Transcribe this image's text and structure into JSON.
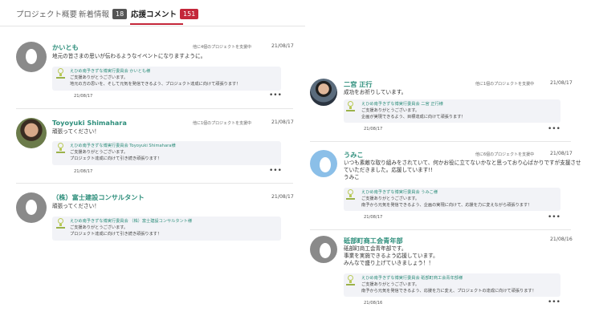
{
  "tabs": [
    {
      "label": "プロジェクト概要"
    },
    {
      "label": "新着情報",
      "badge": "18",
      "badge_color": "#555555"
    },
    {
      "label": "応援コメント",
      "badge": "151",
      "badge_color": "#c4273a"
    }
  ],
  "accent_color": "#c4273a",
  "name_color": "#2f8f7c",
  "comments": [
    {
      "name": "かいとも",
      "support": "他に4個のプロジェクトを支援中",
      "date": "21/08/17",
      "body": [
        "地元の皆さまの思いが伝わるようなイベントになりますように。"
      ],
      "reply": [
        "えひめ南予きずな博実行委員会 かいとも様",
        "ご支援ありがとうございます。",
        "地元の方の思いを、そして元気を発信できるよう、プロジェクト達成に向けて頑張ります！"
      ],
      "reply_date": "21/08/17",
      "avatar": "default-gray"
    },
    {
      "name": "Toyoyuki Shimahara",
      "support": "他に1個のプロジェクトを支援中",
      "date": "21/08/17",
      "body": [
        "頑張ってください！"
      ],
      "reply": [
        "えひめ南予きずな博実行委員会 Toyoyuki Shimahara様",
        "ご支援ありがとうございます。",
        "プロジェクト達成に向けて引き続き頑張ります！"
      ],
      "reply_date": "21/08/17",
      "avatar": "photo"
    },
    {
      "name": "（株）富士建設コンサルタント",
      "support": "",
      "date": "21/08/17",
      "body": [
        "頑張ってください！"
      ],
      "reply": [
        "えひめ南予きずな博実行委員会 （株）富士建設コンサルタント様",
        "ご支援ありがとうございます。",
        "プロジェクト達成に向けて引き続き頑張ります！"
      ],
      "reply_date": "",
      "avatar": "default-gray"
    },
    {
      "name": "二宮 正行",
      "support": "他に1個のプロジェクトを支援中",
      "date": "21/08/17",
      "body": [
        "成功をお祈りしています。"
      ],
      "reply": [
        "えひめ南予きずな博実行委員会 二宮 正行様",
        "ご支援ありがとうございます。",
        "企画が実現できるよう、目標達成に向けて頑張ります！"
      ],
      "reply_date": "21/08/17",
      "avatar": "photo"
    },
    {
      "name": "うみこ",
      "support": "他に6個のプロジェクトを支援中",
      "date": "21/08/17",
      "body": [
        "いつも素敵な取り組みをされていて、何かお役に立てないかなと思っており心ばかりですが支援させ",
        "ていただきました。応援しています!!",
        "うみこ"
      ],
      "reply": [
        "えひめ南予きずな博実行委員会 うみこ様",
        "ご支援ありがとうございます。",
        "南予から元気を発信できるよう、企画の実現に向けて、応援を力に変えながら頑張ります！"
      ],
      "reply_date": "21/08/17",
      "avatar": "default-blue"
    },
    {
      "name": "砥部町商工会青年部",
      "support": "",
      "date": "21/08/16",
      "body": [
        "砥部町商工会青年部です。",
        "事業を実施できるよう応援しています。",
        "みんなで盛り上げていきましょう！！"
      ],
      "reply": [
        "えひめ南予きずな博実行委員会 砥部町商工会青年部様",
        "ご支援ありがとうございます。",
        "南予から元気を発信できるよう、応援を力に変え、プロジェクトの達成に向けて頑張ります！"
      ],
      "reply_date": "21/08/16",
      "avatar": "default-gray"
    }
  ],
  "more_label": "•••"
}
